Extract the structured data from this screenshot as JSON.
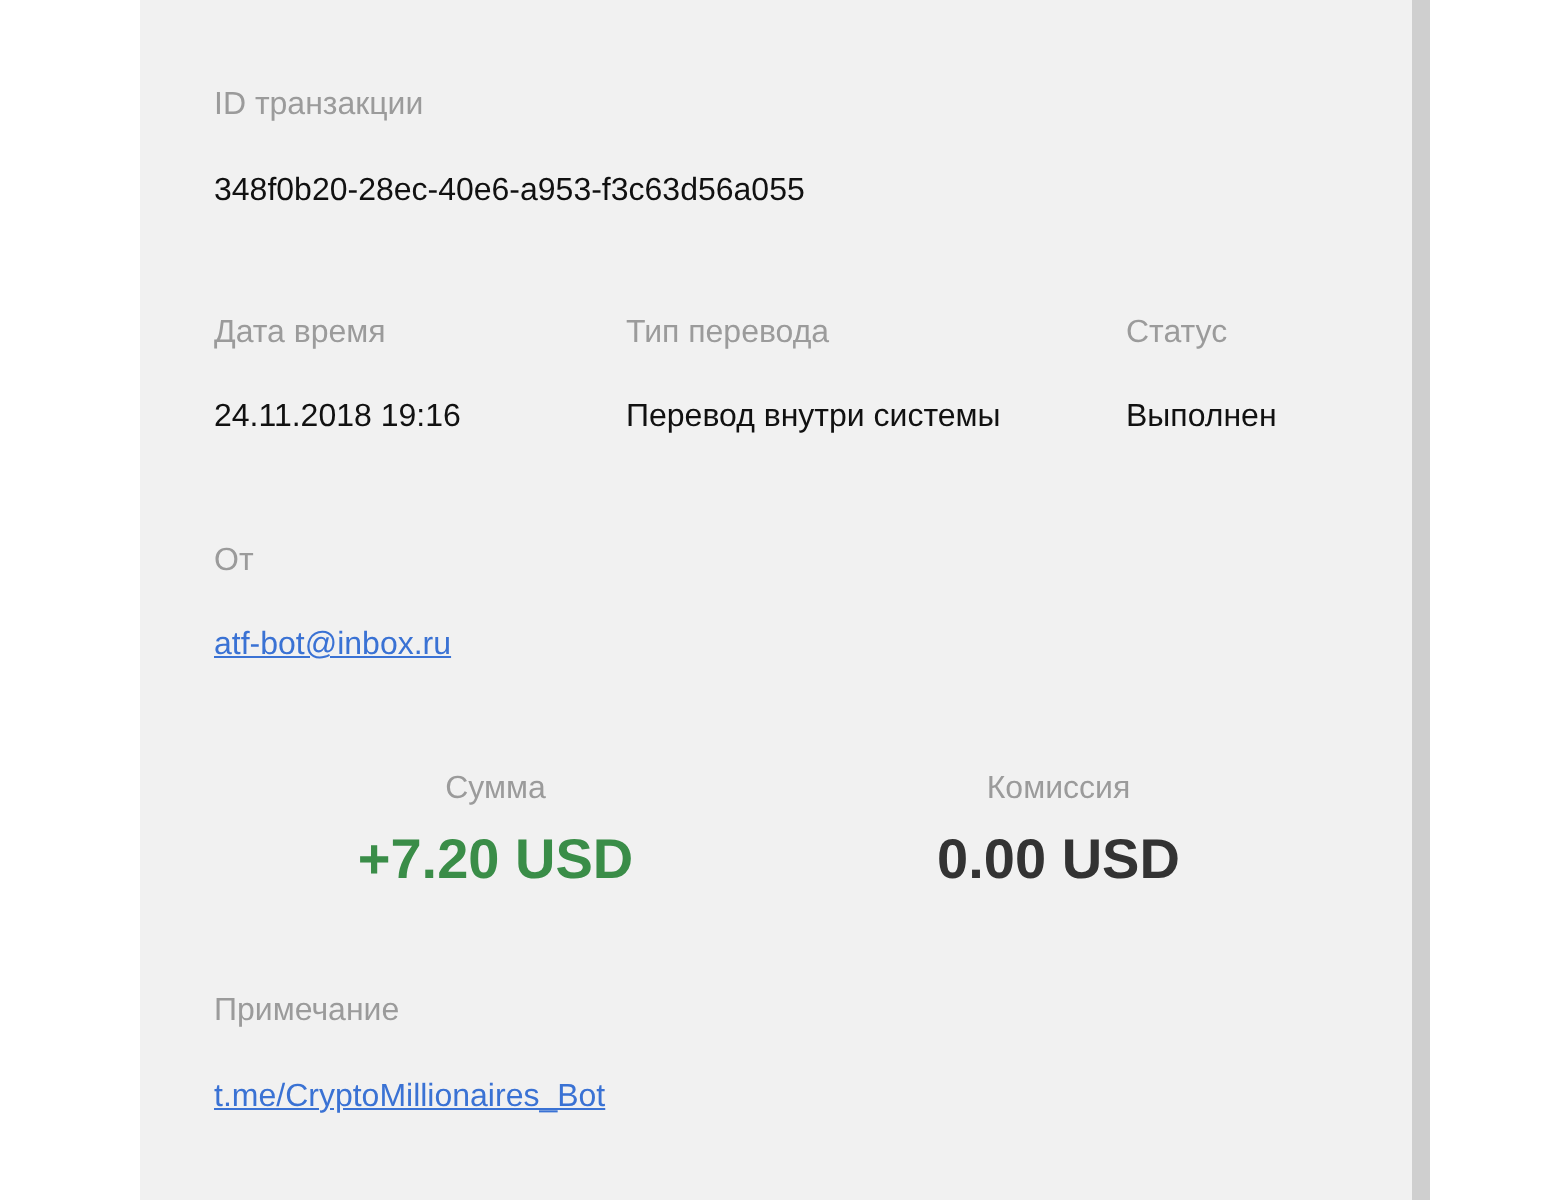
{
  "transaction_id": {
    "label": "ID транзакции",
    "value": "348f0b20-28ec-40e6-a953-f3c63d56a055"
  },
  "details": [
    {
      "label": "Дата время",
      "value": "24.11.2018 19:16"
    },
    {
      "label": "Тип перевода",
      "value": "Перевод внутри системы"
    },
    {
      "label": "Статус",
      "value": "Выполнен"
    }
  ],
  "sender": {
    "label": "От",
    "value": "atf-bot@inbox.ru"
  },
  "amounts": [
    {
      "label": "Сумма",
      "value": "+7.20 USD",
      "kind": "credit"
    },
    {
      "label": "Комиссия",
      "value": "0.00 USD",
      "kind": "neutral"
    }
  ],
  "note": {
    "label": "Примечание",
    "value": "t.me/CryptoMillionaires_Bot"
  }
}
